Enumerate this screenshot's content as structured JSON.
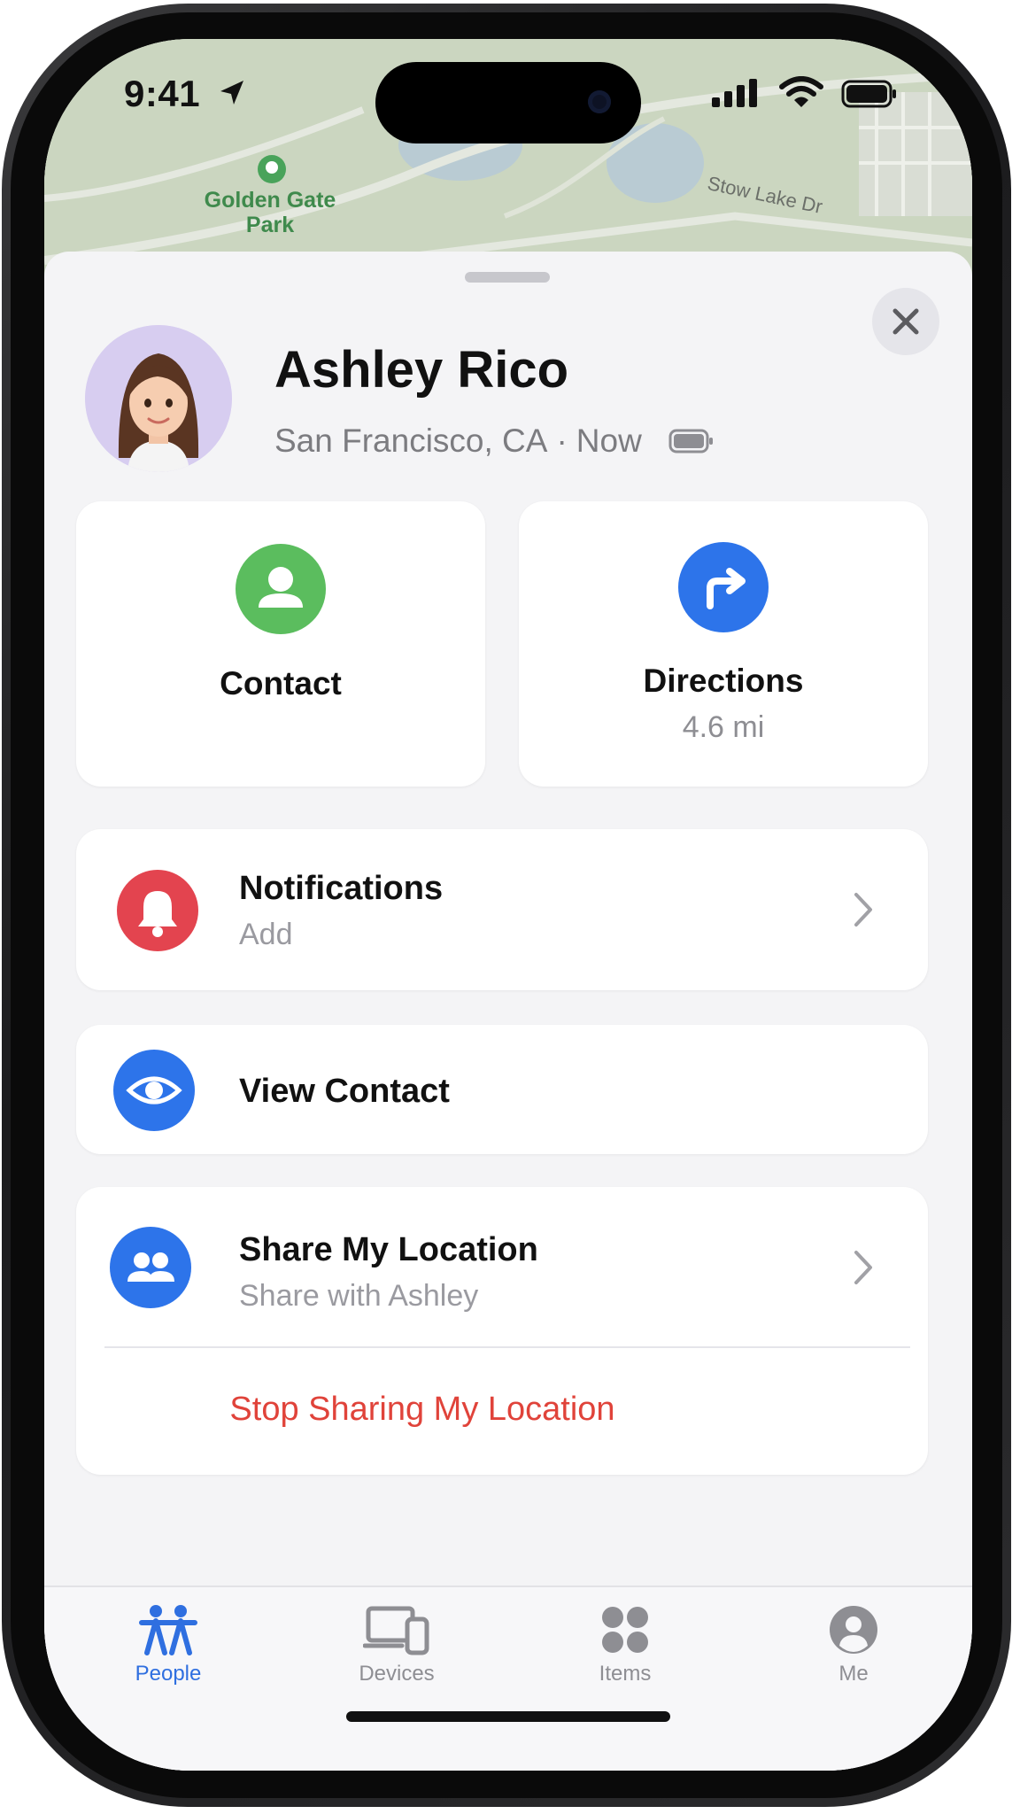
{
  "status_bar": {
    "time": "9:41"
  },
  "map": {
    "park_label": "Golden Gate Park",
    "street_label": "Stow Lake Dr"
  },
  "person": {
    "name": "Ashley Rico",
    "location": "San Francisco, CA",
    "separator": "·",
    "updated": "Now"
  },
  "actions": {
    "contact_label": "Contact",
    "directions_label": "Directions",
    "directions_distance": "4.6 mi"
  },
  "rows": {
    "notifications_title": "Notifications",
    "notifications_sub": "Add",
    "view_contact_title": "View Contact",
    "share_title": "Share My Location",
    "share_sub": "Share with Ashley",
    "stop_sharing": "Stop Sharing My Location"
  },
  "tabs": [
    {
      "label": "People",
      "icon": "people-icon",
      "active": true
    },
    {
      "label": "Devices",
      "icon": "devices-icon",
      "active": false
    },
    {
      "label": "Items",
      "icon": "items-icon",
      "active": false
    },
    {
      "label": "Me",
      "icon": "me-icon",
      "active": false
    }
  ],
  "colors": {
    "accent": "#2f6fe0",
    "contact_green": "#5bbd5e",
    "directions_blue": "#2d74ea",
    "notifications_red": "#e3444f",
    "destructive": "#e0433a"
  }
}
